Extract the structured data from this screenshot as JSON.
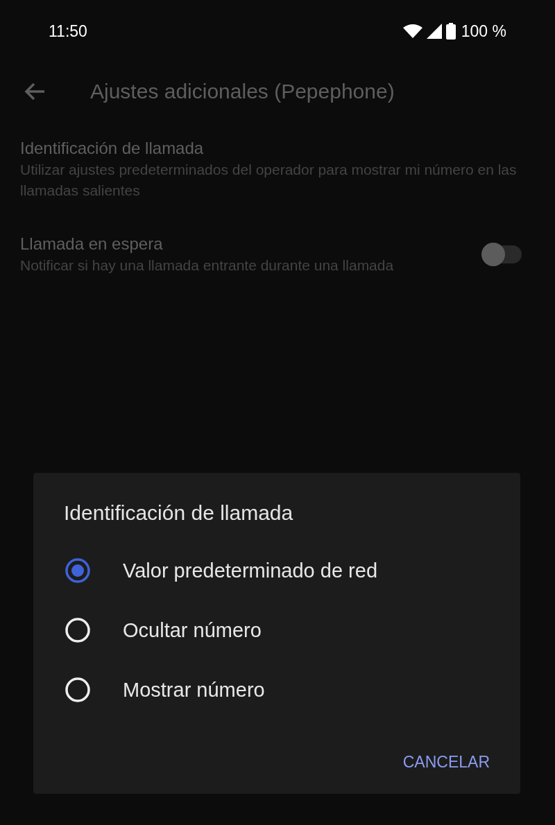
{
  "status_bar": {
    "time": "11:50",
    "battery_text": "100 %"
  },
  "app_bar": {
    "title": "Ajustes adicionales (Pepephone)"
  },
  "settings": [
    {
      "kind": "text",
      "title": "Identificación de llamada",
      "summary": "Utilizar ajustes predeterminados del operador para mostrar mi número en las llamadas salientes"
    },
    {
      "kind": "switch",
      "title": "Llamada en espera",
      "summary": "Notificar si hay una llamada entrante durante una llamada",
      "on": false
    }
  ],
  "dialog": {
    "title": "Identificación de llamada",
    "options": [
      {
        "label": "Valor predeterminado de red",
        "selected": true
      },
      {
        "label": "Ocultar número",
        "selected": false
      },
      {
        "label": "Mostrar número",
        "selected": false
      }
    ],
    "buttons": [
      "CANCELAR"
    ]
  }
}
